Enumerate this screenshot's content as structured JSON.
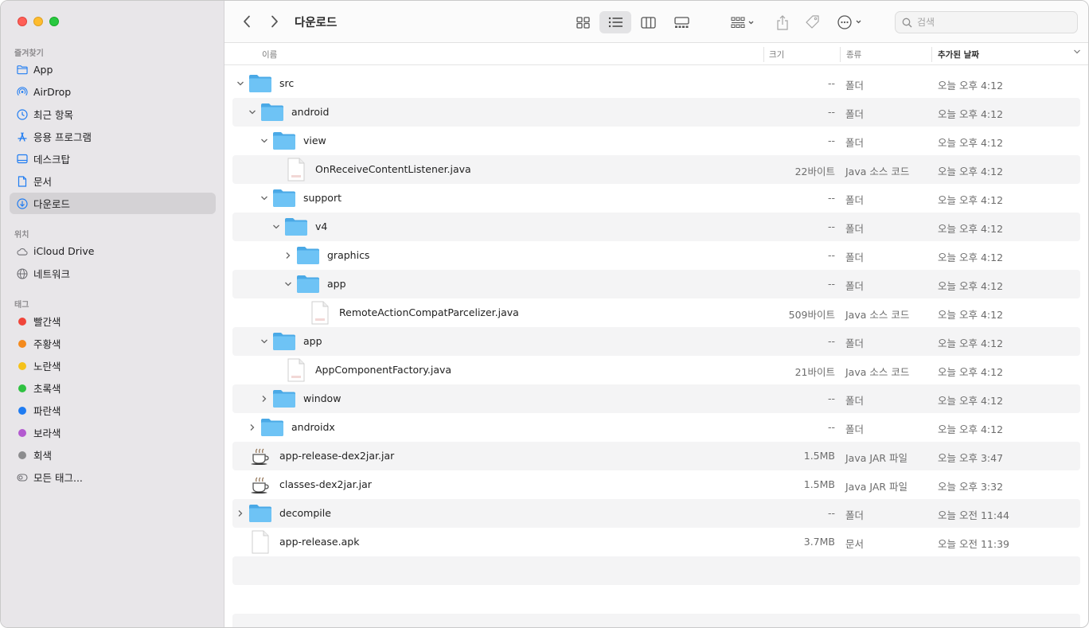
{
  "window": {
    "title": "다운로드"
  },
  "colors": {
    "accent": "#1f7cf2",
    "folder": "#5ab8f0",
    "selected_bg": "#d4d2d5"
  },
  "sidebar": {
    "favorites_title": "즐겨찾기",
    "favorites": [
      {
        "label": "App",
        "icon": "folder-icon"
      },
      {
        "label": "AirDrop",
        "icon": "airdrop-icon"
      },
      {
        "label": "최근 항목",
        "icon": "clock-icon"
      },
      {
        "label": "응용 프로그램",
        "icon": "applications-icon"
      },
      {
        "label": "데스크탑",
        "icon": "desktop-icon"
      },
      {
        "label": "문서",
        "icon": "document-icon"
      },
      {
        "label": "다운로드",
        "icon": "download-icon",
        "selected": true
      }
    ],
    "locations_title": "위치",
    "locations": [
      {
        "label": "iCloud Drive",
        "icon": "cloud-icon"
      },
      {
        "label": "네트워크",
        "icon": "network-icon"
      }
    ],
    "tags_title": "태그",
    "tags": [
      {
        "label": "빨간색",
        "color": "#f0453a"
      },
      {
        "label": "주황색",
        "color": "#f48a1d"
      },
      {
        "label": "노란색",
        "color": "#f5c21b"
      },
      {
        "label": "초록색",
        "color": "#2fc141"
      },
      {
        "label": "파란색",
        "color": "#1f7cf2"
      },
      {
        "label": "보라색",
        "color": "#b35ad0"
      },
      {
        "label": "회색",
        "color": "#8c8c8e"
      },
      {
        "label": "모든 태그...",
        "icon": "all-tags-icon"
      }
    ]
  },
  "toolbar": {
    "search_placeholder": "검색"
  },
  "columns": {
    "name": "이름",
    "size": "크기",
    "kind": "종류",
    "date": "추가된 날짜"
  },
  "rows": [
    {
      "name": "src",
      "type": "folder",
      "level": 0,
      "disclosure": "open",
      "size": "--",
      "kind": "폴더",
      "date": "오늘 오후 4:12"
    },
    {
      "name": "android",
      "type": "folder",
      "level": 1,
      "disclosure": "open",
      "size": "--",
      "kind": "폴더",
      "date": "오늘 오후 4:12"
    },
    {
      "name": "view",
      "type": "folder",
      "level": 2,
      "disclosure": "open",
      "size": "--",
      "kind": "폴더",
      "date": "오늘 오후 4:12"
    },
    {
      "name": "OnReceiveContentListener.java",
      "type": "java",
      "level": 3,
      "disclosure": "none",
      "size": "22바이트",
      "kind": "Java 소스 코드",
      "date": "오늘 오후 4:12"
    },
    {
      "name": "support",
      "type": "folder",
      "level": 2,
      "disclosure": "open",
      "size": "--",
      "kind": "폴더",
      "date": "오늘 오후 4:12"
    },
    {
      "name": "v4",
      "type": "folder",
      "level": 3,
      "disclosure": "open",
      "size": "--",
      "kind": "폴더",
      "date": "오늘 오후 4:12"
    },
    {
      "name": "graphics",
      "type": "folder",
      "level": 4,
      "disclosure": "closed",
      "size": "--",
      "kind": "폴더",
      "date": "오늘 오후 4:12"
    },
    {
      "name": "app",
      "type": "folder",
      "level": 4,
      "disclosure": "open",
      "size": "--",
      "kind": "폴더",
      "date": "오늘 오후 4:12"
    },
    {
      "name": "RemoteActionCompatParcelizer.java",
      "type": "java",
      "level": 5,
      "disclosure": "none",
      "size": "509바이트",
      "kind": "Java 소스 코드",
      "date": "오늘 오후 4:12"
    },
    {
      "name": "app",
      "type": "folder",
      "level": 2,
      "disclosure": "open",
      "size": "--",
      "kind": "폴더",
      "date": "오늘 오후 4:12"
    },
    {
      "name": "AppComponentFactory.java",
      "type": "java",
      "level": 3,
      "disclosure": "none",
      "size": "21바이트",
      "kind": "Java 소스 코드",
      "date": "오늘 오후 4:12"
    },
    {
      "name": "window",
      "type": "folder",
      "level": 2,
      "disclosure": "closed",
      "size": "--",
      "kind": "폴더",
      "date": "오늘 오후 4:12"
    },
    {
      "name": "androidx",
      "type": "folder",
      "level": 1,
      "disclosure": "closed",
      "size": "--",
      "kind": "폴더",
      "date": "오늘 오후 4:12"
    },
    {
      "name": "app-release-dex2jar.jar",
      "type": "jar",
      "level": 0,
      "disclosure": "none",
      "size": "1.5MB",
      "kind": "Java JAR 파일",
      "date": "오늘 오후 3:47"
    },
    {
      "name": "classes-dex2jar.jar",
      "type": "jar",
      "level": 0,
      "disclosure": "none",
      "size": "1.5MB",
      "kind": "Java JAR 파일",
      "date": "오늘 오후 3:32"
    },
    {
      "name": "decompile",
      "type": "folder",
      "level": 0,
      "disclosure": "closed",
      "size": "--",
      "kind": "폴더",
      "date": "오늘 오전 11:44"
    },
    {
      "name": "app-release.apk",
      "type": "doc",
      "level": 0,
      "disclosure": "none",
      "size": "3.7MB",
      "kind": "문서",
      "date": "오늘 오전 11:39"
    }
  ]
}
